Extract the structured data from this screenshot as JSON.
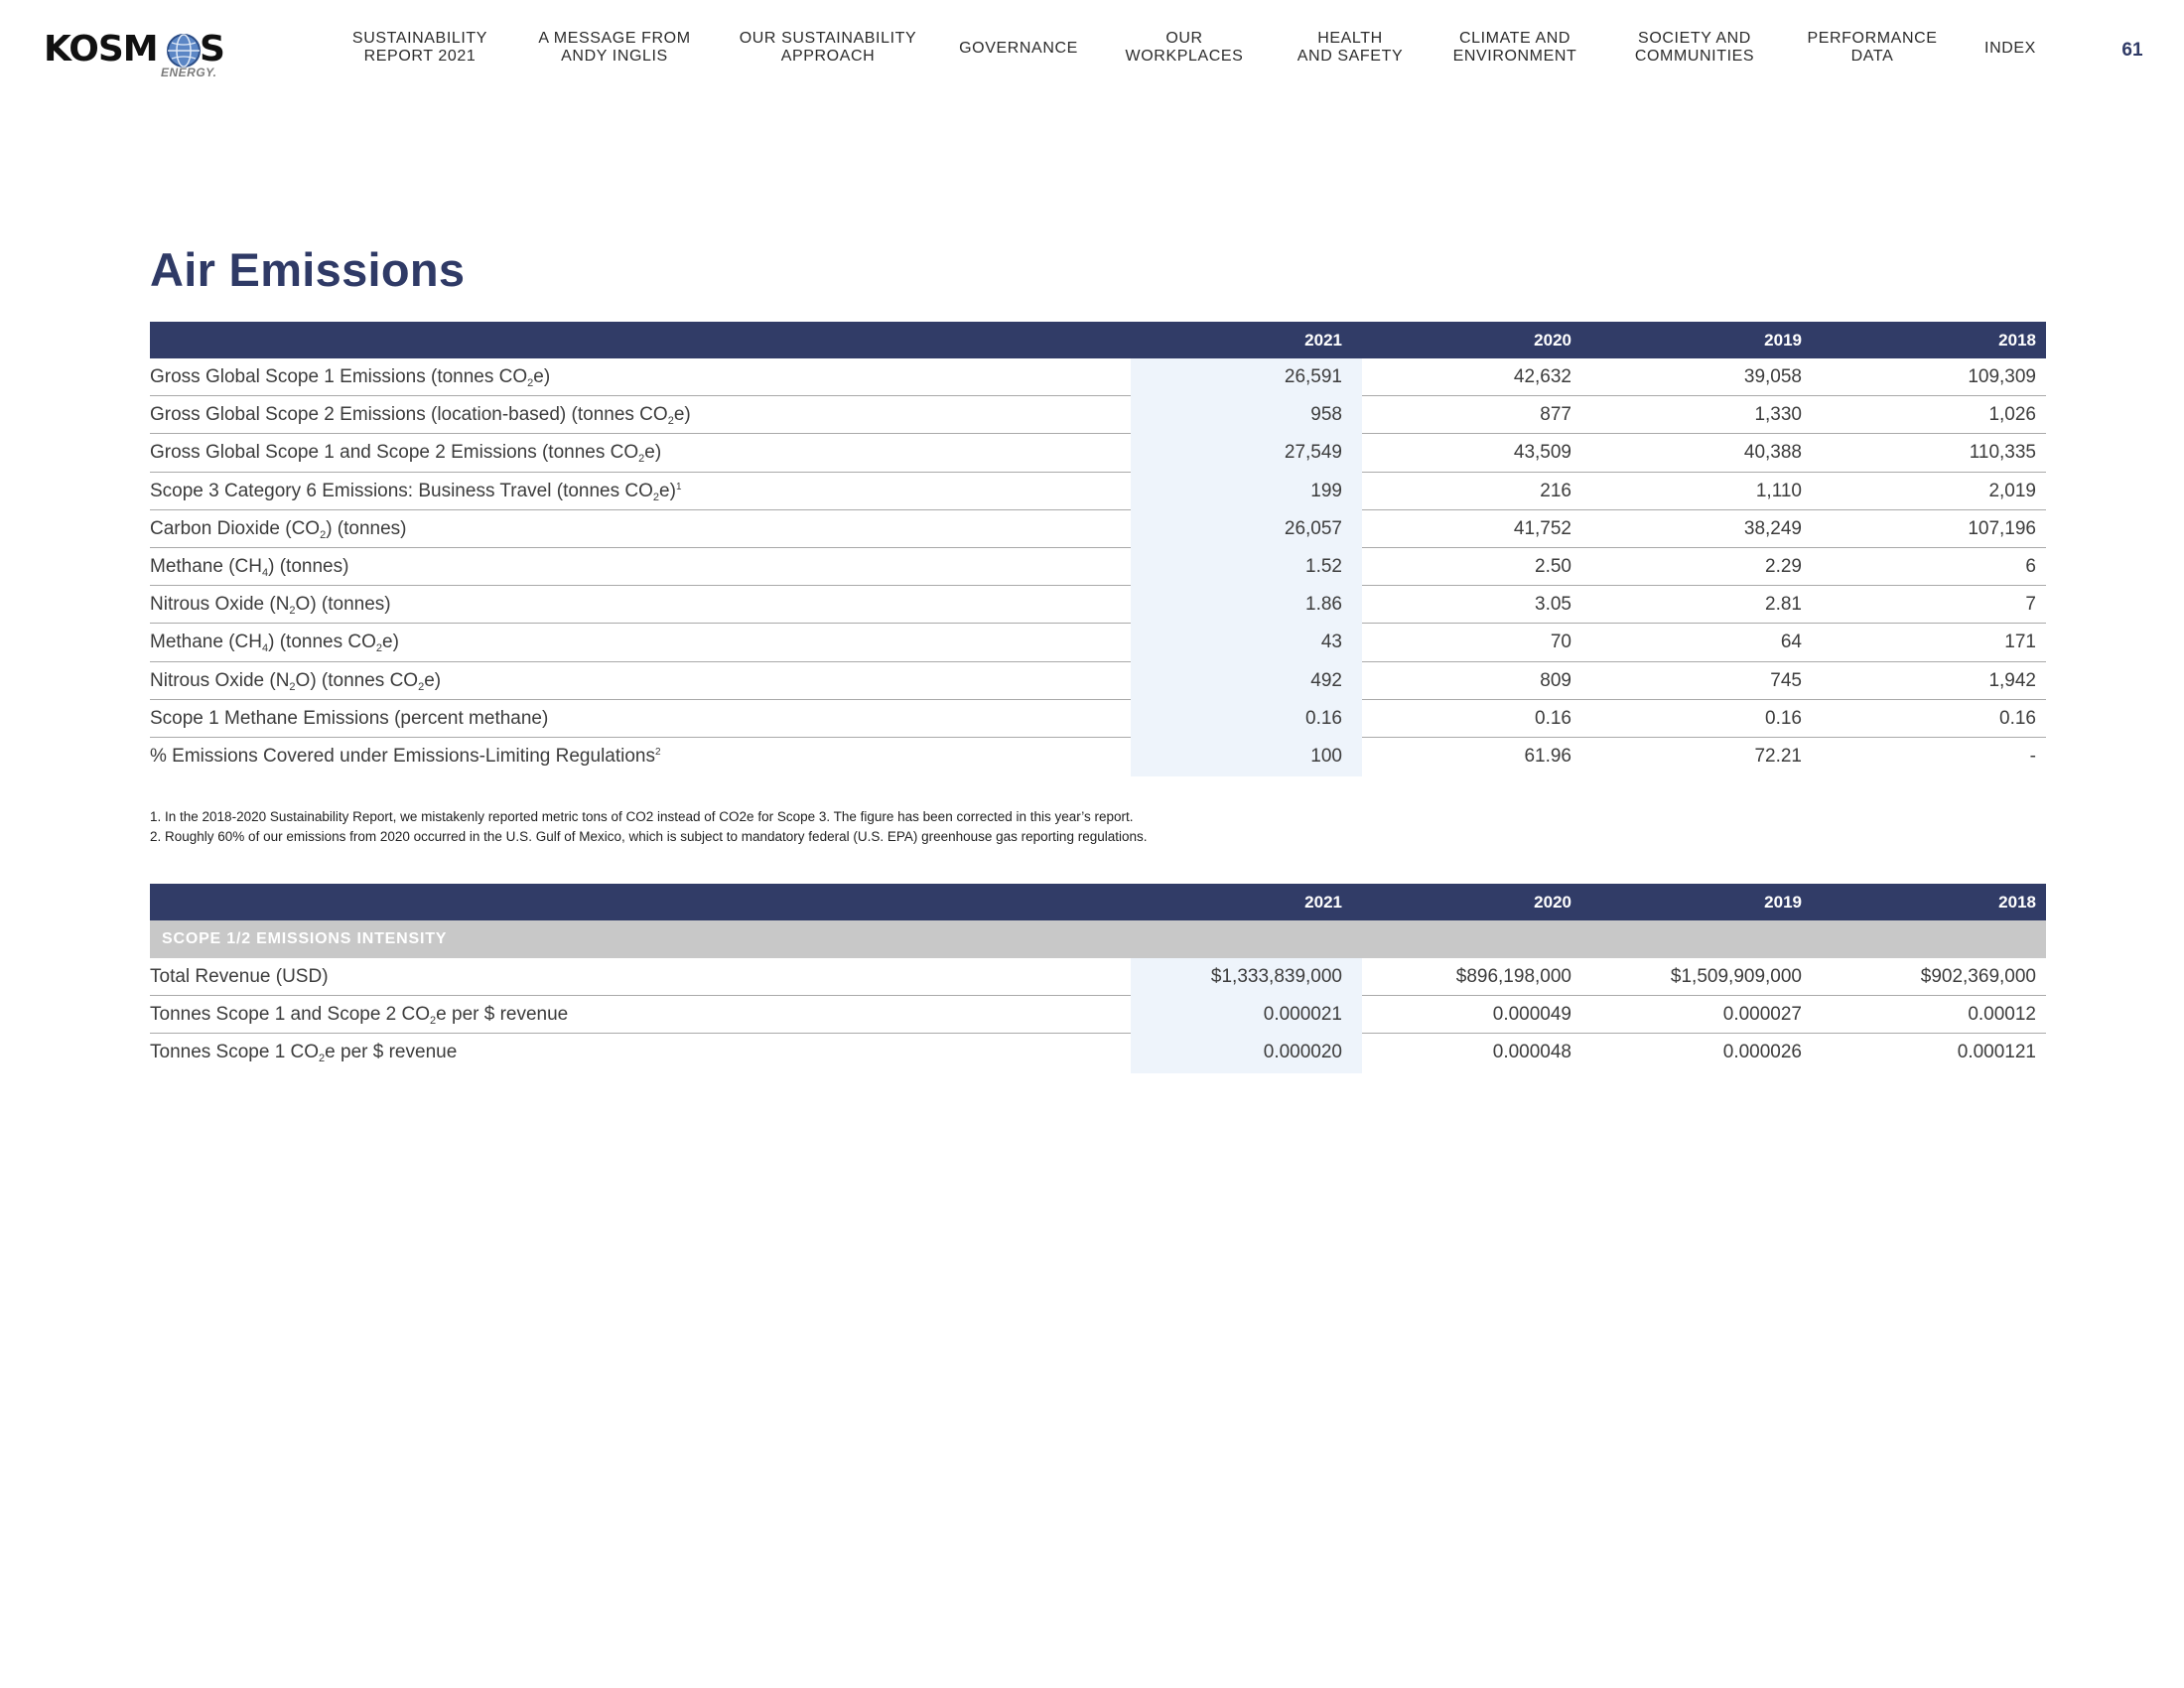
{
  "header": {
    "logo_text": "KOSM",
    "logo_last": "S",
    "logo_sub": "ENERGY.",
    "nav": [
      {
        "line1": "SUSTAINABILITY",
        "line2": "REPORT 2021"
      },
      {
        "line1": "A MESSAGE FROM",
        "line2": "ANDY INGLIS"
      },
      {
        "line1": "OUR SUSTAINABILITY",
        "line2": "APPROACH"
      },
      {
        "line1": "GOVERNANCE",
        "line2": ""
      },
      {
        "line1": "OUR",
        "line2": "WORKPLACES"
      },
      {
        "line1": "HEALTH",
        "line2": "AND SAFETY"
      },
      {
        "line1": "CLIMATE AND",
        "line2": "ENVIRONMENT"
      },
      {
        "line1": "SOCIETY AND",
        "line2": "COMMUNITIES"
      },
      {
        "line1": "PERFORMANCE",
        "line2": "DATA"
      },
      {
        "line1": "INDEX",
        "line2": ""
      }
    ],
    "page_number": "61"
  },
  "title": "Air Emissions",
  "emissions_table": {
    "years": [
      "2021",
      "2020",
      "2019",
      "2018"
    ],
    "rows": [
      {
        "label_parts": [
          "Gross Global Scope 1 Emissions (tonnes CO",
          "2",
          "e)",
          ""
        ],
        "values": [
          "26,591",
          "42,632",
          "39,058",
          "109,309"
        ]
      },
      {
        "label_parts": [
          "Gross Global Scope 2 Emissions (location-based) (tonnes CO",
          "2",
          "e)",
          ""
        ],
        "values": [
          "958",
          "877",
          "1,330",
          "1,026"
        ]
      },
      {
        "label_parts": [
          "Gross Global Scope 1 and Scope 2 Emissions (tonnes CO",
          "2",
          "e)",
          ""
        ],
        "values": [
          "27,549",
          "43,509",
          "40,388",
          "110,335"
        ]
      },
      {
        "label_parts": [
          "Scope 3 Category 6 Emissions: Business Travel (tonnes CO",
          "2",
          "e)",
          "1"
        ],
        "values": [
          "199",
          "216",
          "1,110",
          "2,019"
        ]
      },
      {
        "label_parts": [
          "Carbon Dioxide (CO",
          "2",
          ") (tonnes)",
          ""
        ],
        "values": [
          "26,057",
          "41,752",
          "38,249",
          "107,196"
        ]
      },
      {
        "label_parts": [
          "Methane (CH",
          "4",
          ") (tonnes)",
          ""
        ],
        "values": [
          "1.52",
          "2.50",
          "2.29",
          "6"
        ]
      },
      {
        "label_parts": [
          "Nitrous Oxide (N",
          "2",
          "O) (tonnes)",
          ""
        ],
        "values": [
          "1.86",
          "3.05",
          "2.81",
          "7"
        ]
      },
      {
        "label_parts": [
          "Methane (CH",
          "4",
          ") (tonnes CO",
          "2",
          "e)"
        ],
        "values": [
          "43",
          "70",
          "64",
          "171"
        ]
      },
      {
        "label_parts": [
          "Nitrous Oxide (N",
          "2",
          "O) (tonnes CO",
          "2",
          "e)"
        ],
        "values": [
          "492",
          "809",
          "745",
          "1,942"
        ]
      },
      {
        "label_parts": [
          "Scope 1 Methane Emissions (percent methane)",
          "",
          "",
          ""
        ],
        "values": [
          "0.16",
          "0.16",
          "0.16",
          "0.16"
        ]
      },
      {
        "label_parts": [
          "% Emissions Covered under Emissions-Limiting Regulations",
          "",
          "",
          "2"
        ],
        "values": [
          "100",
          "61.96",
          "72.21",
          "-"
        ]
      }
    ]
  },
  "footnotes": [
    "1.  In the 2018-2020 Sustainability Report, we mistakenly reported metric tons of CO2 instead of CO2e for Scope 3. The figure has been corrected in this year’s report.",
    "2.  Roughly 60% of our emissions from 2020 occurred in the U.S. Gulf of Mexico, which is subject to mandatory federal (U.S. EPA) greenhouse gas reporting regulations."
  ],
  "intensity_table": {
    "years": [
      "2021",
      "2020",
      "2019",
      "2018"
    ],
    "section_label": "SCOPE 1/2 EMISSIONS INTENSITY",
    "rows": [
      {
        "label_parts": [
          "Total Revenue (USD)",
          "",
          ""
        ],
        "values": [
          "$1,333,839,000",
          "$896,198,000",
          "$1,509,909,000",
          "$902,369,000"
        ]
      },
      {
        "label_parts": [
          "Tonnes Scope 1 and Scope 2 CO",
          "2",
          "e per $ revenue"
        ],
        "values": [
          "0.000021",
          "0.000049",
          "0.000027",
          "0.00012"
        ]
      },
      {
        "label_parts": [
          "Tonnes Scope 1 CO",
          "2",
          "e per $ revenue"
        ],
        "values": [
          "0.000020",
          "0.000048",
          "0.000026",
          "0.000121"
        ]
      }
    ]
  },
  "colors": {
    "navy": "#313c67",
    "title": "#2f3a66",
    "highlight": "#eef4fb",
    "section_gray": "#c8c8c8"
  }
}
